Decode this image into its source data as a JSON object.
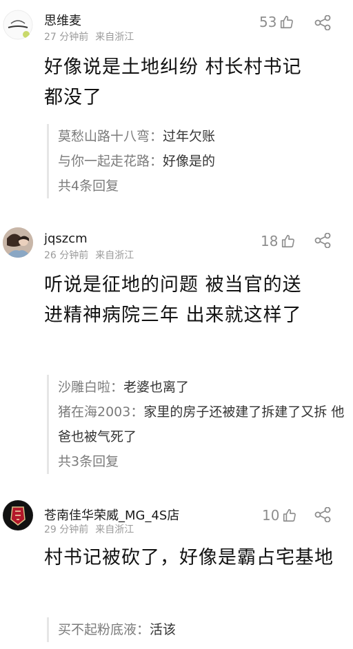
{
  "comments": [
    {
      "username": "思维麦",
      "time": "27 分钟前",
      "location": "来自浙江",
      "likes": "53",
      "text": "好像说是土地纠纷 村长村书记都没了",
      "replies": [
        {
          "name": "莫愁山路十八弯",
          "text": "过年欠账"
        },
        {
          "name": "与你一起走花路",
          "text": "好像是的"
        }
      ],
      "reply_count": "共4条回复"
    },
    {
      "username": "jqszcm",
      "time": "26 分钟前",
      "location": "来自浙江",
      "likes": "18",
      "text": "听说是征地的问题 被当官的送进精神病院三年 出来就这样了",
      "replies": [
        {
          "name": "沙雕白啦",
          "text": "老婆也离了"
        },
        {
          "name": "猪在海2003",
          "text": "家里的房子还被建了拆建了又拆 他爸也被气死了"
        }
      ],
      "reply_count": "共3条回复"
    },
    {
      "username": "苍南佳华荣威_MG_4S店",
      "time": "29 分钟前",
      "location": "来自浙江",
      "likes": "10",
      "text": "村书记被砍了，好像是霸占宅基地",
      "replies": [
        {
          "name": "买不起粉底液",
          "text": "活该"
        }
      ]
    }
  ],
  "reply_separator": "："
}
